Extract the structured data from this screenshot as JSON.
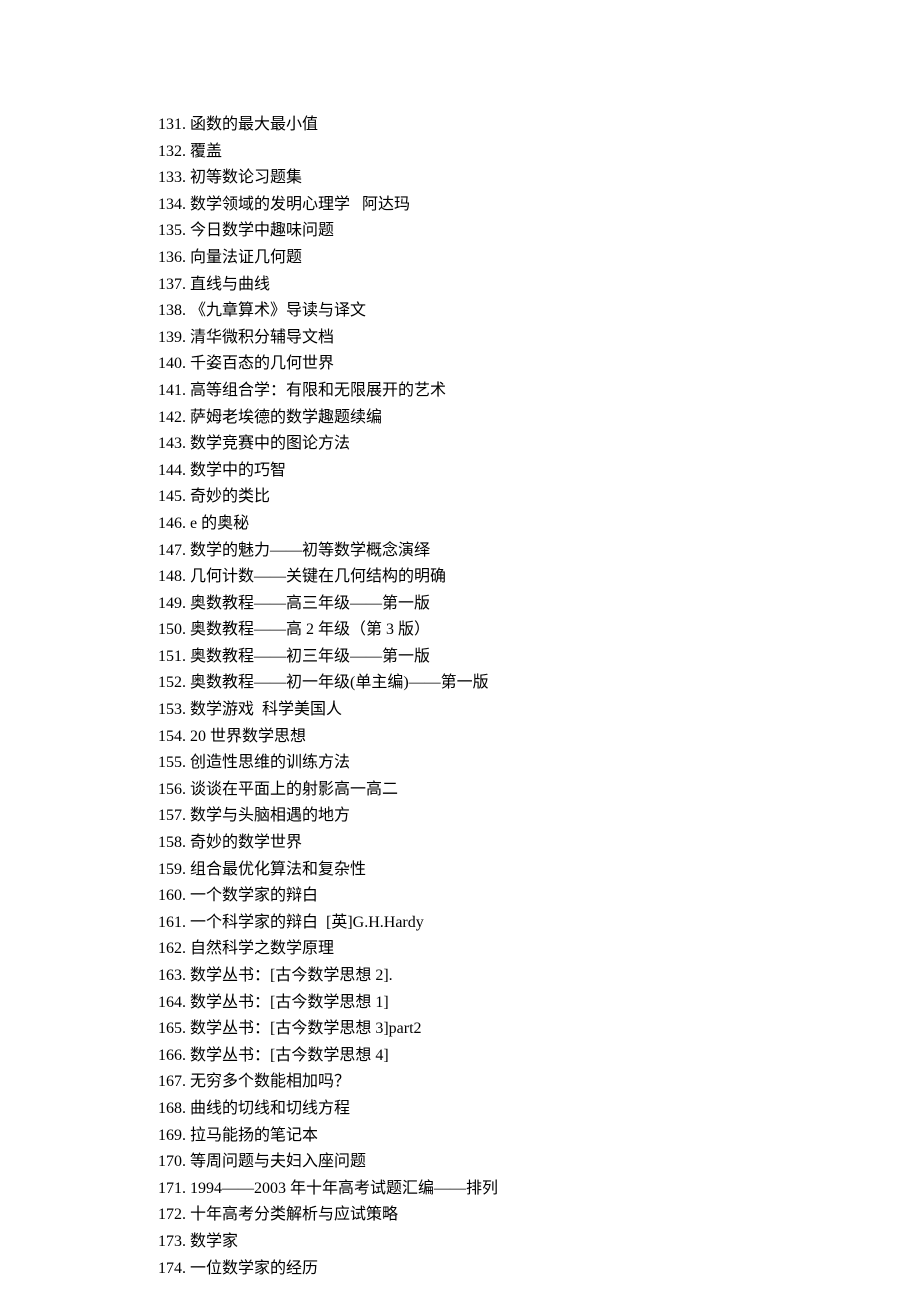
{
  "items": [
    {
      "num": "131",
      "text": "函数的最大最小值"
    },
    {
      "num": "132",
      "text": "覆盖"
    },
    {
      "num": "133",
      "text": "初等数论习题集"
    },
    {
      "num": "134",
      "text": "数学领域的发明心理学   阿达玛"
    },
    {
      "num": "135",
      "text": "今日数学中趣味问题"
    },
    {
      "num": "136",
      "text": "向量法证几何题"
    },
    {
      "num": "137",
      "text": "直线与曲线"
    },
    {
      "num": "138",
      "text": "《九章算术》导读与译文"
    },
    {
      "num": "139",
      "text": "清华微积分辅导文档"
    },
    {
      "num": "140",
      "text": "千姿百态的几何世界"
    },
    {
      "num": "141",
      "text": "高等组合学：有限和无限展开的艺术"
    },
    {
      "num": "142",
      "text": "萨姆老埃德的数学趣题续编"
    },
    {
      "num": "143",
      "text": "数学竞赛中的图论方法"
    },
    {
      "num": "144",
      "text": "数学中的巧智"
    },
    {
      "num": "145",
      "text": "奇妙的类比"
    },
    {
      "num": "146",
      "text": "e 的奥秘"
    },
    {
      "num": "147",
      "text": "数学的魅力——初等数学概念演绎"
    },
    {
      "num": "148",
      "text": "几何计数——关键在几何结构的明确"
    },
    {
      "num": "149",
      "text": "奥数教程——高三年级——第一版"
    },
    {
      "num": "150",
      "text": "奥数教程——高 2 年级（第 3 版）"
    },
    {
      "num": "151",
      "text": "奥数教程——初三年级——第一版"
    },
    {
      "num": "152",
      "text": "奥数教程——初一年级(单主编)——第一版"
    },
    {
      "num": "153",
      "text": "数学游戏  科学美国人"
    },
    {
      "num": "154",
      "text": "20 世界数学思想"
    },
    {
      "num": "155",
      "text": "创造性思维的训练方法"
    },
    {
      "num": "156",
      "text": "谈谈在平面上的射影高一高二"
    },
    {
      "num": "157",
      "text": "数学与头脑相遇的地方"
    },
    {
      "num": "158",
      "text": "奇妙的数学世界"
    },
    {
      "num": "159",
      "text": "组合最优化算法和复杂性"
    },
    {
      "num": "160",
      "text": "一个数学家的辩白"
    },
    {
      "num": "161",
      "text": "一个科学家的辩白  [英]G.H.Hardy"
    },
    {
      "num": "162",
      "text": "自然科学之数学原理"
    },
    {
      "num": "163",
      "text": "数学丛书：[古今数学思想 2]."
    },
    {
      "num": "164",
      "text": "数学丛书：[古今数学思想 1]"
    },
    {
      "num": "165",
      "text": "数学丛书：[古今数学思想 3]part2"
    },
    {
      "num": "166",
      "text": "数学丛书：[古今数学思想 4]"
    },
    {
      "num": "167",
      "text": "无穷多个数能相加吗？"
    },
    {
      "num": "168",
      "text": "曲线的切线和切线方程"
    },
    {
      "num": "169",
      "text": "拉马能扬的笔记本"
    },
    {
      "num": "170",
      "text": "等周问题与夫妇入座问题"
    },
    {
      "num": "171",
      "text": "1994——2003 年十年高考试题汇编——排列"
    },
    {
      "num": "172",
      "text": "十年高考分类解析与应试策略"
    },
    {
      "num": "173",
      "text": "数学家"
    },
    {
      "num": "174",
      "text": "一位数学家的经历"
    }
  ]
}
